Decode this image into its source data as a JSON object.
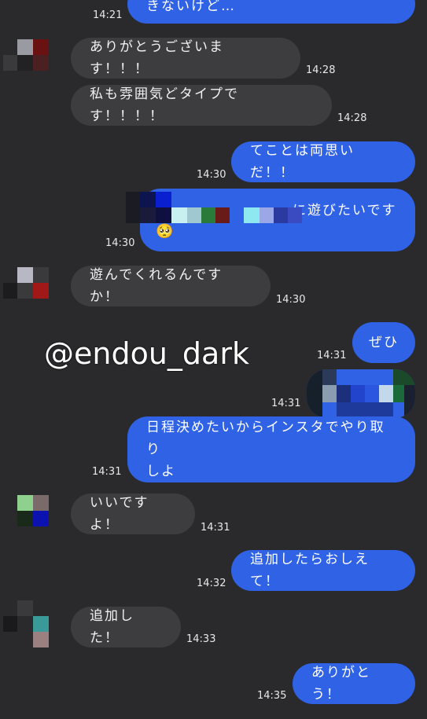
{
  "watermark": "@endou_dark",
  "messages": [
    {
      "text": "きないけど…",
      "time": "14:21"
    },
    {
      "text": "ありがとうございます！！！",
      "time": "14:28"
    },
    {
      "text": "私も雰囲気どタイプです！！！！",
      "time": "14:28"
    },
    {
      "text": "てことは両思いだ！！",
      "time": "14:30"
    },
    {
      "text": "に遊びたいです",
      "time": "14:30",
      "emoji": "🥺"
    },
    {
      "text": "遊んでくれるんですか！",
      "time": "14:30"
    },
    {
      "text": "ぜひ",
      "time": "14:31"
    },
    {
      "text": "",
      "time": "14:31"
    },
    {
      "text_line1": "日程決めたいからインスタでやり取り",
      "text_line2": "しよ",
      "time": "14:31"
    },
    {
      "text": "いいですよ！",
      "time": "14:31"
    },
    {
      "text": "追加したらおしえて！",
      "time": "14:32"
    },
    {
      "text": "追加した！",
      "time": "14:33"
    },
    {
      "text": "ありがとう！",
      "time": "14:35"
    }
  ],
  "colors": {
    "background": "#2a2a2c",
    "incoming_bubble": "#3d3d40",
    "outgoing_bubble": "#2f62e4"
  }
}
